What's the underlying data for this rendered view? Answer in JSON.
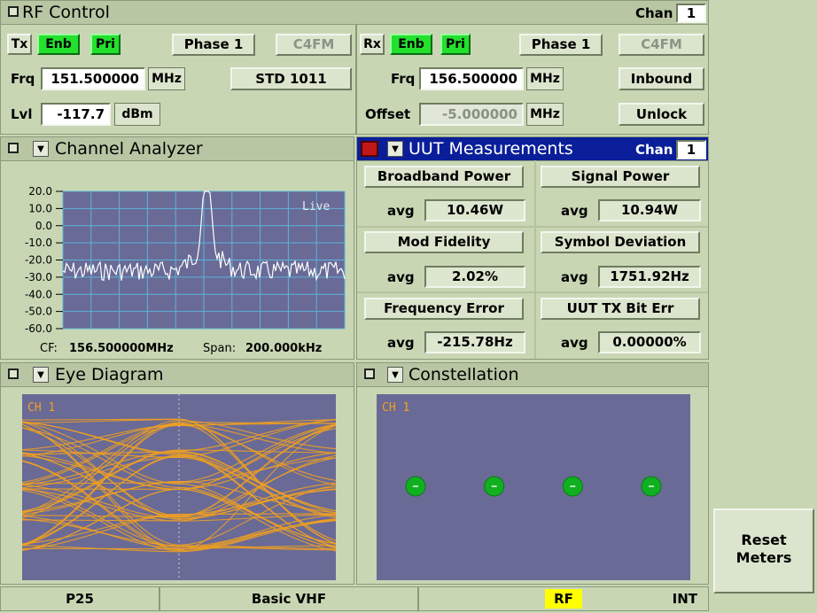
{
  "rf_control": {
    "title": "RF Control",
    "chan_label": "Chan",
    "chan_value": "1",
    "tx": {
      "label": "Tx",
      "enb": "Enb",
      "pri": "Pri",
      "phase": "Phase 1",
      "mode": "C4FM",
      "frq_label": "Frq",
      "frq_value": "151.500000",
      "frq_unit": "MHz",
      "std": "STD 1011",
      "lvl_label": "Lvl",
      "lvl_value": "-117.7",
      "lvl_unit": "dBm"
    },
    "rx": {
      "label": "Rx",
      "enb": "Enb",
      "pri": "Pri",
      "phase": "Phase 1",
      "mode": "C4FM",
      "frq_label": "Frq",
      "frq_value": "156.500000",
      "frq_unit": "MHz",
      "inbound": "Inbound",
      "offset_label": "Offset",
      "offset_value": "-5.000000",
      "offset_unit": "MHz",
      "unlock": "Unlock"
    }
  },
  "channel_analyzer": {
    "title": "Channel Analyzer",
    "y_ticks": [
      "20.0",
      "10.0",
      "0.0",
      "-10.0",
      "-20.0",
      "-30.0",
      "-40.0",
      "-50.0",
      "-60.0"
    ],
    "live": "Live",
    "cf_label": "CF:",
    "cf_value": "156.500000MHz",
    "span_label": "Span:",
    "span_value": "200.000kHz",
    "trace_color": "#ffffff",
    "plot_bg": "#6a6a96",
    "grid_color": "#5ab4dc"
  },
  "uut": {
    "title": "UUT Measurements",
    "chan_label": "Chan",
    "chan_value": "1",
    "header_color": "#0a1e9a",
    "measurements": [
      {
        "name": "Broadband Power",
        "avg": "avg",
        "value": "10.46W"
      },
      {
        "name": "Signal Power",
        "avg": "avg",
        "value": "10.94W"
      },
      {
        "name": "Mod Fidelity",
        "avg": "avg",
        "value": "2.02%"
      },
      {
        "name": "Symbol Deviation",
        "avg": "avg",
        "value": "1751.92Hz"
      },
      {
        "name": "Frequency Error",
        "avg": "avg",
        "value": "-215.78Hz"
      },
      {
        "name": "UUT TX Bit Err",
        "avg": "avg",
        "value": "0.00000%"
      }
    ]
  },
  "eye_diagram": {
    "title": "Eye Diagram",
    "channel": "CH 1",
    "trace_color": "#f0a020"
  },
  "constellation": {
    "title": "Constellation",
    "channel": "CH 1",
    "symbol_count": 4,
    "symbol_color": "#10b020"
  },
  "reset_meters": {
    "line1": "Reset",
    "line2": "Meters"
  },
  "status_bar": {
    "standard": "P25",
    "test": "Basic VHF",
    "mode": "RF",
    "ref": "INT",
    "mode_color": "#ffff00"
  },
  "icons": {
    "pane_toggle": "square-icon",
    "dropdown": "triangle-down-icon"
  }
}
